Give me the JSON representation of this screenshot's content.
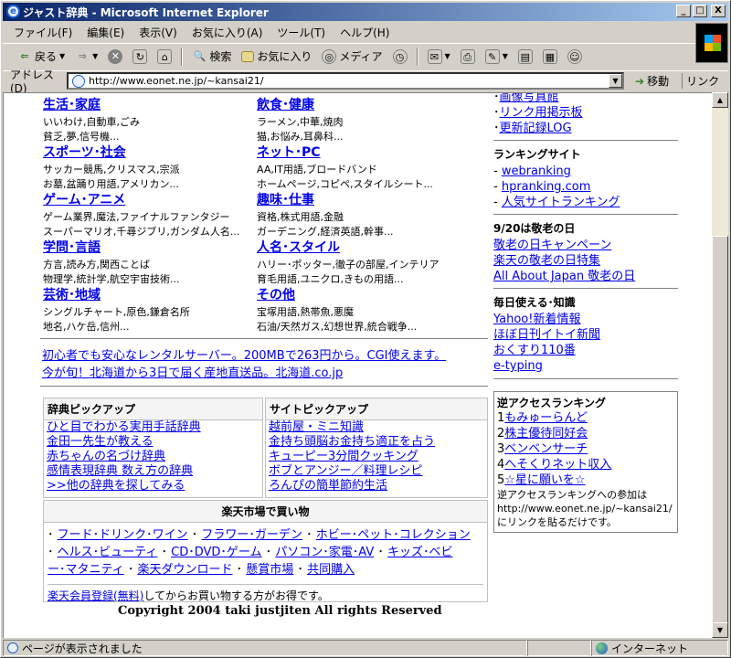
{
  "window": {
    "title": "ジャスト辞典 - Microsoft Internet Explorer",
    "ie_icon": "e",
    "btn_min": "_",
    "btn_max": "□",
    "btn_close": "X"
  },
  "menubar": [
    "ファイル(F)",
    "編集(E)",
    "表示(V)",
    "お気に入り(A)",
    "ツール(T)",
    "ヘルプ(H)"
  ],
  "toolbar": {
    "back": "戻る",
    "search": "検索",
    "favorites": "お気に入り",
    "media": "メディア"
  },
  "address": {
    "label": "アドレス(D)",
    "url": "http://www.eonet.ne.jp/~kansai21/",
    "go": "移動",
    "links": "リンク"
  },
  "categories": [
    {
      "title": "生活･家庭",
      "lines": [
        "いいわけ,自動車,ごみ",
        "貧乏,夢,信号機..."
      ]
    },
    {
      "title": "飲食･健康",
      "lines": [
        "ラーメン,中華,焼肉",
        "猫,お悩み,耳鼻科..."
      ]
    },
    {
      "title": "スポーツ･社会",
      "lines": [
        "サッカー競馬,クリスマス,宗派",
        "お墓,盆踊り用語,アメリカン..."
      ]
    },
    {
      "title": "ネット･PC",
      "lines": [
        "AA,IT用語,ブロードバンド",
        "ホームページ,コピペ,スタイルシート..."
      ]
    },
    {
      "title": "ゲーム･アニメ",
      "lines": [
        "ゲーム業界,魔法,ファイナルファンタジー",
        "スーパーマリオ,千尋ジブリ,ガンダム人名..."
      ]
    },
    {
      "title": "趣味･仕事",
      "lines": [
        "資格,株式用語,金融",
        "ガーデニング,経済英語,幹事..."
      ]
    },
    {
      "title": "学問･言語",
      "lines": [
        "方言,読み方,関西ことば",
        "物理学,統計学,航空宇宙技術..."
      ]
    },
    {
      "title": "人名･スタイル",
      "lines": [
        "ハリー･ポッター,徹子の部屋,インテリア",
        "育毛用語,ユニクロ,きもの用語..."
      ]
    },
    {
      "title": "芸術･地域",
      "lines": [
        "シングルチャート,原色,鎌倉名所",
        "地名,ハケ岳,信州..."
      ]
    },
    {
      "title": "その他",
      "lines": [
        "宝塚用語,熱帯魚,悪魔",
        "石油/天然ガス,幻想世界,統合戦争..."
      ]
    }
  ],
  "promos": [
    "初心者でも安心なレンタルサーバー。200MBで263円から。CGI使えます。",
    "今が旬！北海道から3日で届く産地直送品。北海道.co.jp"
  ],
  "dict_pickup": {
    "header": "辞典ピックアップ",
    "items": [
      "ひと目でわかる実用手話辞典",
      "金田一先生が教える",
      "赤ちゃんの名づけ辞典",
      "感情表現辞典 数え方の辞典",
      ">>他の辞典を探してみる"
    ]
  },
  "site_pickup": {
    "header": "サイトピックアップ",
    "items": [
      "越前屋・ミニ知識",
      "金持ち頭脳お金持ち適正を占う",
      "キューピー3分間クッキング",
      "ボブとアンジー／料理レシピ",
      "ろんぴの簡単節約生活"
    ]
  },
  "rakuten": {
    "header": "楽天市場で買い物",
    "line1": [
      "フード･ドリンク･ワイン",
      "フラワー･ガーデン",
      "ホビー･ペット･コレクション"
    ],
    "line2a": [
      "ヘルス･ビューティ",
      "CD･DVD･ゲーム",
      "パソコン･家電･AV",
      "キッズ･ベビ"
    ],
    "line3": [
      "ー･マタニティ",
      "楽天ダウンロード",
      "懸賞市場",
      "共同購入"
    ],
    "member_link": "楽天会員登録(無料)",
    "member_text": "してからお買い物する方がお得です。"
  },
  "copyright": "Copyright 2004 taki justjiten All rights Reserved",
  "sidebar_top": [
    "画像写真館",
    "リンク用掲示板",
    "更新記録LOG"
  ],
  "ranking": {
    "header": "ランキングサイト",
    "items": [
      "webranking",
      "hpranking.com",
      "人気サイトランキング"
    ]
  },
  "keiro": {
    "header": "9/20は敬老の日",
    "items": [
      "敬老の日キャンペーン",
      "楽天の敬老の日特集",
      "All About Japan 敬老の日"
    ]
  },
  "daily": {
    "header": "毎日使える･知識",
    "items": [
      "Yahoo!新着情報",
      "ほぼ日刊イトイ新聞",
      "おくすり110番",
      "e-typing"
    ]
  },
  "access": {
    "header": "逆アクセスランキング",
    "items": [
      {
        "num": "1",
        "name": "もみゅーらんど"
      },
      {
        "num": "2",
        "name": "株主優待同好会"
      },
      {
        "num": "3",
        "name": "ベンベンサーチ"
      },
      {
        "num": "4",
        "name": "へそくりネット収入"
      },
      {
        "num": "5",
        "name": "☆星に願いを☆"
      }
    ],
    "note1": "逆アクセスランキングへの参加は",
    "note2": "http://www.eonet.ne.jp/~kansai21/",
    "note3": "にリンクを貼るだけです。"
  },
  "status": {
    "left": "ページが表示されました",
    "zone": "インターネット"
  }
}
